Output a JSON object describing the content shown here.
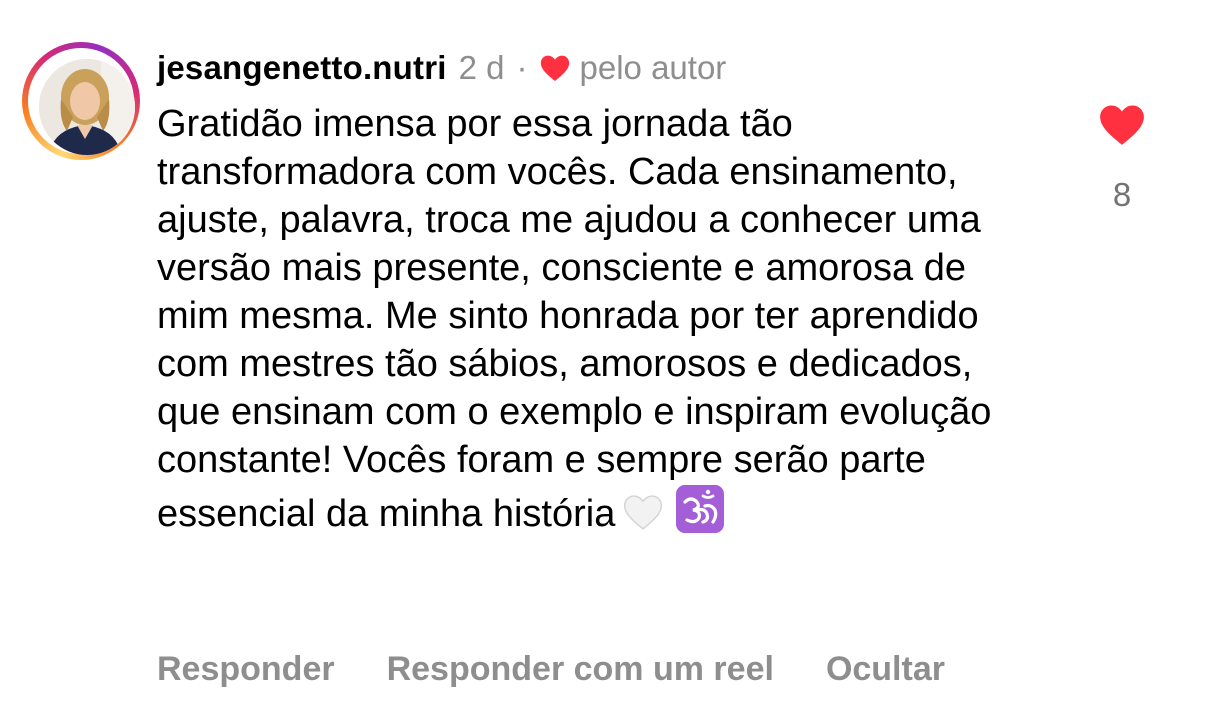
{
  "comment": {
    "username": "jesangenetto.nutri",
    "time": "2 d",
    "separator": "·",
    "liked_by_author_label": "pelo autor",
    "text": "Gratidão imensa por essa jornada tão transformadora com vocês. Cada ensinamento, ajuste, palavra, troca me ajudou a conhecer uma versão mais presente, consciente e amorosa de mim mesma. Me sinto honrada por ter aprendido com mestres tão sábios, amorosos e dedicados, que ensinam com o exemplo e inspiram evolução constante! Vocês foram e sempre serão parte essencial da minha história",
    "trailing_emojis": [
      "white-heart-emoji",
      "om-emoji"
    ],
    "like_count": "8",
    "like_icon": "heart-filled-icon",
    "like_color": "#ff3040"
  },
  "actions": {
    "reply": "Responder",
    "reply_with_reel": "Responder com um reel",
    "hide": "Ocultar"
  },
  "colors": {
    "secondary_text": "#8e8e8e",
    "like_red": "#ff3040",
    "om_purple": "#a45fd8"
  }
}
